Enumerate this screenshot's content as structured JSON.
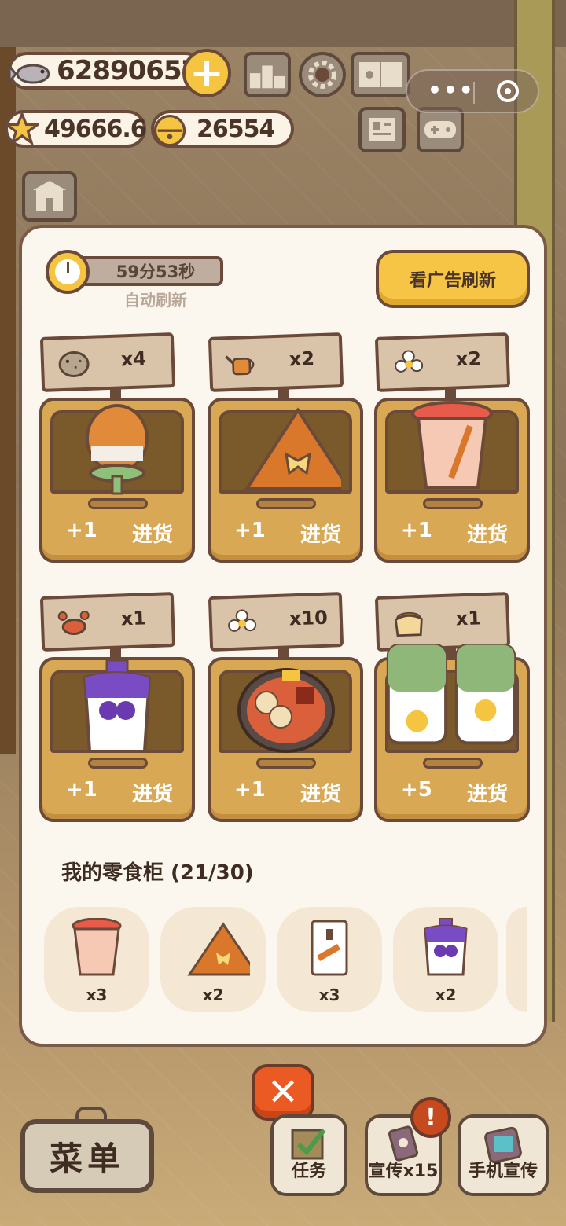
{
  "hud": {
    "fish_value": "62890657",
    "star_value": "49666.6",
    "bell_value": "26554",
    "plus_label": "+"
  },
  "panel": {
    "timer": "59分53秒",
    "auto_refresh": "自动刷新",
    "ad_refresh": "看广告刷新",
    "slots": [
      {
        "icon": "pufferfish-icon",
        "count": "x4",
        "plus": "+1",
        "restock": "进货",
        "item": "bulb-lollipop"
      },
      {
        "icon": "watering-can-icon",
        "count": "x2",
        "plus": "+1",
        "restock": "进货",
        "item": "tortilla-chip"
      },
      {
        "icon": "flower-icon",
        "count": "x2",
        "plus": "+1",
        "restock": "进货",
        "item": "noodle-cup"
      },
      {
        "icon": "crab-icon",
        "count": "x1",
        "plus": "+1",
        "restock": "进货",
        "item": "grape-pouch"
      },
      {
        "icon": "flower-icon",
        "count": "x10",
        "plus": "+1",
        "restock": "进货",
        "item": "hotpot"
      },
      {
        "icon": "grain-sack-icon",
        "count": "x1",
        "plus": "+5",
        "restock": "进货",
        "item": "green-cans"
      }
    ],
    "cabinet_title": "我的零食柜 (21/30)",
    "cabinet_items": [
      {
        "icon": "noodle-cup-icon",
        "count": "x3"
      },
      {
        "icon": "tortilla-chip-icon",
        "count": "x2"
      },
      {
        "icon": "snack-bag-icon",
        "count": "x3"
      },
      {
        "icon": "grape-pouch-icon",
        "count": "x2"
      }
    ]
  },
  "bottom": {
    "close_label": "✕",
    "menu_label": "菜单",
    "task_label": "任务",
    "promo_label": "宣传x15",
    "phone_promo_label": "手机宣传",
    "badge": "!"
  },
  "colors": {
    "accent": "#f5c542",
    "outline": "#6b4a3a",
    "panel": "#fcf7ee",
    "close": "#ec5a24"
  }
}
